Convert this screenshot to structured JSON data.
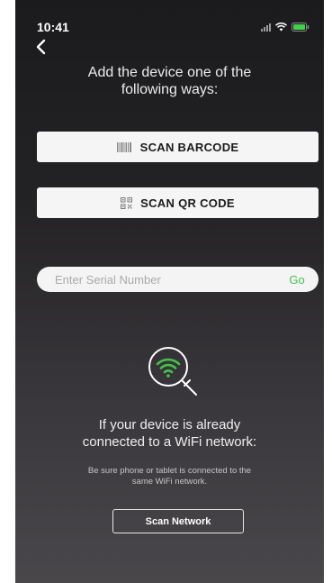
{
  "status_bar": {
    "time": "10:41"
  },
  "add_device": {
    "heading_line1": "Add the device one of the",
    "heading_line2": "following ways:"
  },
  "buttons": {
    "scan_barcode": "SCAN BARCODE",
    "scan_qr": "SCAN QR CODE"
  },
  "serial": {
    "placeholder": "Enter Serial Number",
    "value": "",
    "go_label": "Go"
  },
  "wifi": {
    "heading_line1": "If your device is already",
    "heading_line2": "connected to a WiFi network:",
    "hint_line1": "Be sure phone or tablet is connected to the",
    "hint_line2": "same WiFi network.",
    "scan_network_label": "Scan Network"
  },
  "colors": {
    "accent_green": "#45c24a",
    "battery_green": "#3fd14a",
    "background_top": "#1b1b1d",
    "background_bottom": "#4a474b",
    "button_bg": "#f5f5f5"
  },
  "icons": {
    "back": "chevron-left-icon",
    "barcode": "barcode-icon",
    "qr": "qr-code-icon",
    "search_wifi": "magnifier-wifi-icon",
    "signal": "signal-icon",
    "wifi_status": "wifi-status-icon",
    "battery": "battery-icon"
  }
}
